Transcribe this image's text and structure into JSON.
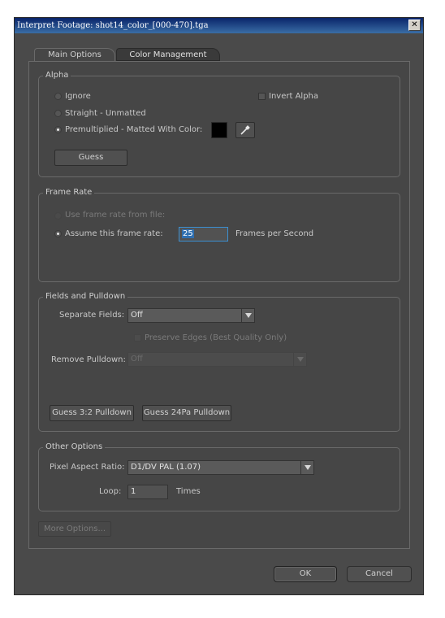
{
  "window": {
    "title": "Interpret Footage: shot14_color_[000-470].tga",
    "close_glyph": "✕"
  },
  "tabs": [
    {
      "label": "Main Options"
    },
    {
      "label": "Color Management"
    }
  ],
  "alpha": {
    "title": "Alpha",
    "ignore_label": "Ignore",
    "straight_label": "Straight - Unmatted",
    "premultiplied_label": "Premultiplied - Matted With Color:",
    "invert_label": "Invert Alpha",
    "matte_color": "#000000",
    "eyedropper_icon": "eyedropper-icon",
    "guess_label": "Guess"
  },
  "frame_rate": {
    "title": "Frame Rate",
    "use_file_label": "Use frame rate from file:",
    "assume_label": "Assume this frame rate:",
    "value": "25",
    "unit_label": "Frames per Second"
  },
  "fields": {
    "title": "Fields and Pulldown",
    "separate_label": "Separate Fields:",
    "separate_value": "Off",
    "preserve_label": "Preserve Edges (Best Quality Only)",
    "remove_label": "Remove Pulldown:",
    "remove_value": "Off",
    "guess32_label": "Guess 3:2 Pulldown",
    "guess24_label": "Guess 24Pa Pulldown"
  },
  "other": {
    "title": "Other Options",
    "par_label": "Pixel Aspect Ratio:",
    "par_value": "D1/DV PAL (1.07)",
    "loop_label": "Loop:",
    "loop_value": "1",
    "times_label": "Times"
  },
  "more_options_label": "More Options...",
  "ok_label": "OK",
  "cancel_label": "Cancel"
}
